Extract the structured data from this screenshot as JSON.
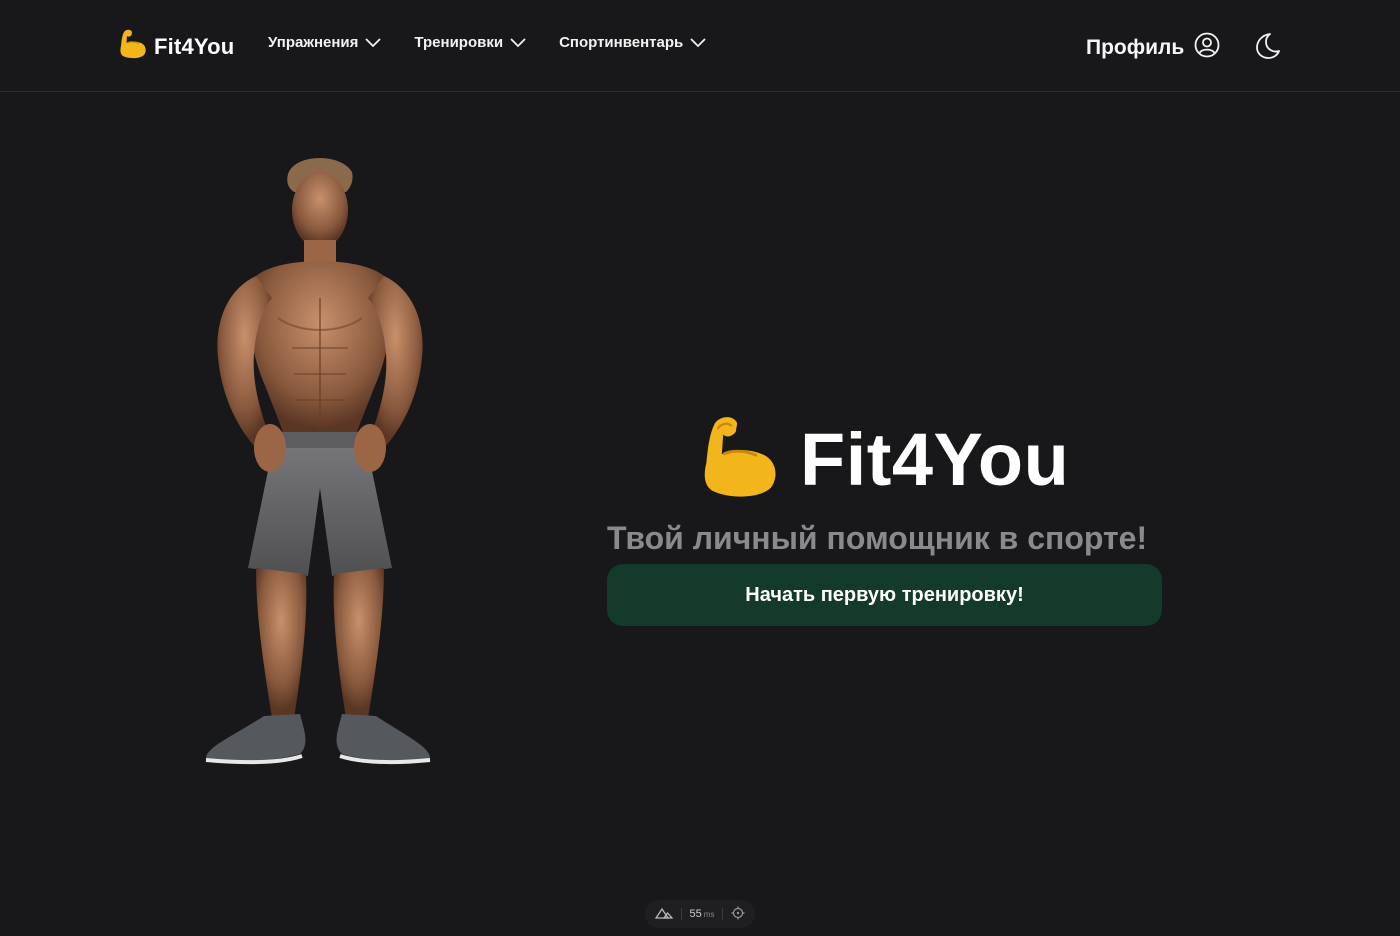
{
  "header": {
    "logo_text": "Fit4You",
    "nav": [
      {
        "label": "Упражнения"
      },
      {
        "label": "Тренировки"
      },
      {
        "label": "Спортинвентарь"
      }
    ],
    "profile_label": "Профиль"
  },
  "hero": {
    "title": "Fit4You",
    "subtitle": "Твой личный помощник в спорте!",
    "cta_label": "Начать первую тренировку!"
  },
  "devtools": {
    "render_time": "55",
    "render_unit": "ms"
  },
  "colors": {
    "background": "#18181a",
    "cta_background": "#143a2b",
    "subtitle": "#8a8a8c"
  },
  "icons": [
    "flexed-biceps-icon",
    "chevron-down-icon",
    "user-circle-icon",
    "moon-icon",
    "nuxt-icon",
    "crosshair-icon"
  ]
}
